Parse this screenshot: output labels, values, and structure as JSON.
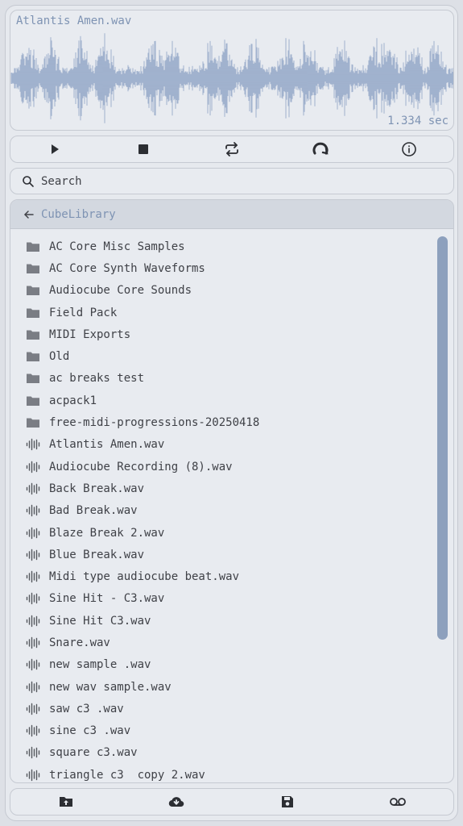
{
  "waveform": {
    "file_name": "Atlantis Amen.wav",
    "duration": "1.334 sec",
    "color": "#8aa0c2"
  },
  "transport": [
    {
      "name": "play",
      "icon": "play-icon"
    },
    {
      "name": "stop",
      "icon": "stop-icon"
    },
    {
      "name": "loop",
      "icon": "loop-icon"
    },
    {
      "name": "reload",
      "icon": "reload-icon"
    },
    {
      "name": "info",
      "icon": "info-icon"
    }
  ],
  "search": {
    "placeholder": "Search",
    "value": ""
  },
  "browser": {
    "path": "CubeLibrary",
    "items": [
      {
        "type": "folder",
        "name": "AC Core Misc Samples"
      },
      {
        "type": "folder",
        "name": "AC Core Synth Waveforms"
      },
      {
        "type": "folder",
        "name": "Audiocube Core Sounds"
      },
      {
        "type": "folder",
        "name": "Field Pack"
      },
      {
        "type": "folder",
        "name": "MIDI Exports"
      },
      {
        "type": "folder",
        "name": "Old"
      },
      {
        "type": "folder",
        "name": "ac breaks test"
      },
      {
        "type": "folder",
        "name": "acpack1"
      },
      {
        "type": "folder",
        "name": "free-midi-progressions-20250418"
      },
      {
        "type": "audio",
        "name": "Atlantis Amen.wav"
      },
      {
        "type": "audio",
        "name": "Audiocube Recording (8).wav"
      },
      {
        "type": "audio",
        "name": "Back Break.wav"
      },
      {
        "type": "audio",
        "name": "Bad Break.wav"
      },
      {
        "type": "audio",
        "name": "Blaze Break 2.wav"
      },
      {
        "type": "audio",
        "name": "Blue Break.wav"
      },
      {
        "type": "audio",
        "name": "Midi type audiocube beat.wav"
      },
      {
        "type": "audio",
        "name": "Sine Hit - C3.wav"
      },
      {
        "type": "audio",
        "name": "Sine Hit C3.wav"
      },
      {
        "type": "audio",
        "name": "Snare.wav"
      },
      {
        "type": "audio",
        "name": "new sample .wav"
      },
      {
        "type": "audio",
        "name": "new wav sample.wav"
      },
      {
        "type": "audio",
        "name": "saw c3 .wav"
      },
      {
        "type": "audio",
        "name": "sine c3 .wav"
      },
      {
        "type": "audio",
        "name": "square c3.wav"
      },
      {
        "type": "audio",
        "name": "triangle c3  copy 2.wav"
      }
    ]
  },
  "footer": [
    {
      "name": "upload",
      "icon": "upload-icon"
    },
    {
      "name": "download",
      "icon": "cloud-download-icon"
    },
    {
      "name": "save",
      "icon": "save-icon"
    },
    {
      "name": "record",
      "icon": "voicemail-icon"
    }
  ],
  "colors": {
    "accent": "#7e93b3",
    "scrollbar": "#8da0bd",
    "icon": "#2c2e33"
  }
}
